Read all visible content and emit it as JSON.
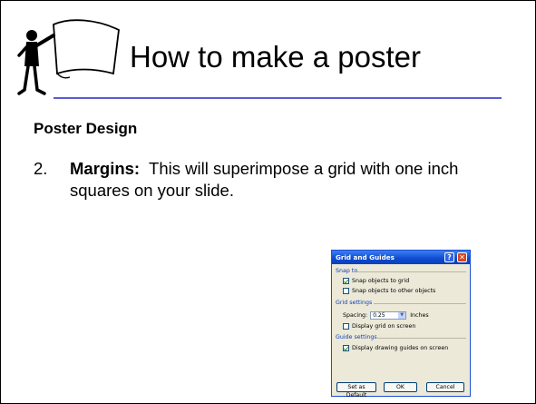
{
  "slide": {
    "title": "How to make a poster",
    "section_heading": "Poster Design",
    "item_number": "2.",
    "item_bold": "Margins:",
    "item_text": "This will superimpose a grid with one inch squares on your slide."
  },
  "dialog": {
    "title": "Grid and Guides",
    "help_glyph": "?",
    "close_glyph": "✕",
    "snap_to_label": "Snap to",
    "snap_objects_grid": "Snap objects to grid",
    "snap_objects_grid_checked": true,
    "snap_objects_other": "Snap objects to other objects",
    "snap_objects_other_checked": false,
    "grid_settings_label": "Grid settings",
    "spacing_label": "Spacing:",
    "spacing_value": "0.25",
    "spacing_unit": "Inches",
    "display_grid": "Display grid on screen",
    "display_grid_checked": false,
    "guide_settings_label": "Guide settings",
    "display_guides": "Display drawing guides on screen",
    "display_guides_checked": true,
    "set_default_button": "Set as Default",
    "ok_button": "OK",
    "cancel_button": "Cancel"
  },
  "colors": {
    "title_rule": "#5b5bd6",
    "dialog_title_bar": "#0d4ad0",
    "dialog_background": "#ece9d8"
  },
  "icons": {
    "logo": "person-holding-sign-icon",
    "dropdown": "chevron-down-icon"
  }
}
